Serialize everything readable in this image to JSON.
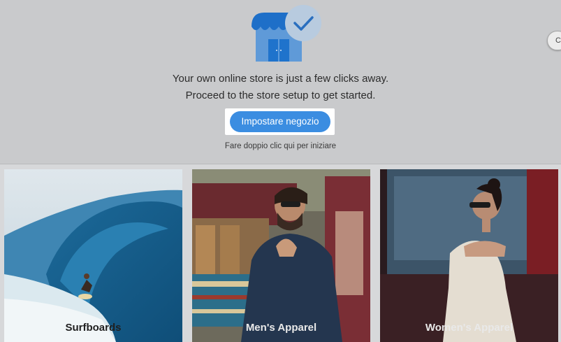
{
  "prompt": {
    "line1": "Your own online store is just a few clicks away.",
    "line2": "Proceed to the store setup to get started.",
    "setup_button": "Impostare negozio",
    "hint": "Fare doppio clic qui per iniziare"
  },
  "side_handle": {
    "label": "C"
  },
  "cards": [
    {
      "label": "Surfboards",
      "icon": "surfer-wave-photo"
    },
    {
      "label": "Men's Apparel",
      "icon": "man-in-shirt-photo"
    },
    {
      "label": "Women's Apparel",
      "icon": "woman-in-dress-photo"
    }
  ],
  "colors": {
    "accent": "#3b8de1",
    "store_icon_blue": "#2f7fd6",
    "check_circle": "#b7cbe0",
    "overlay_bg": "#c9cacc"
  }
}
